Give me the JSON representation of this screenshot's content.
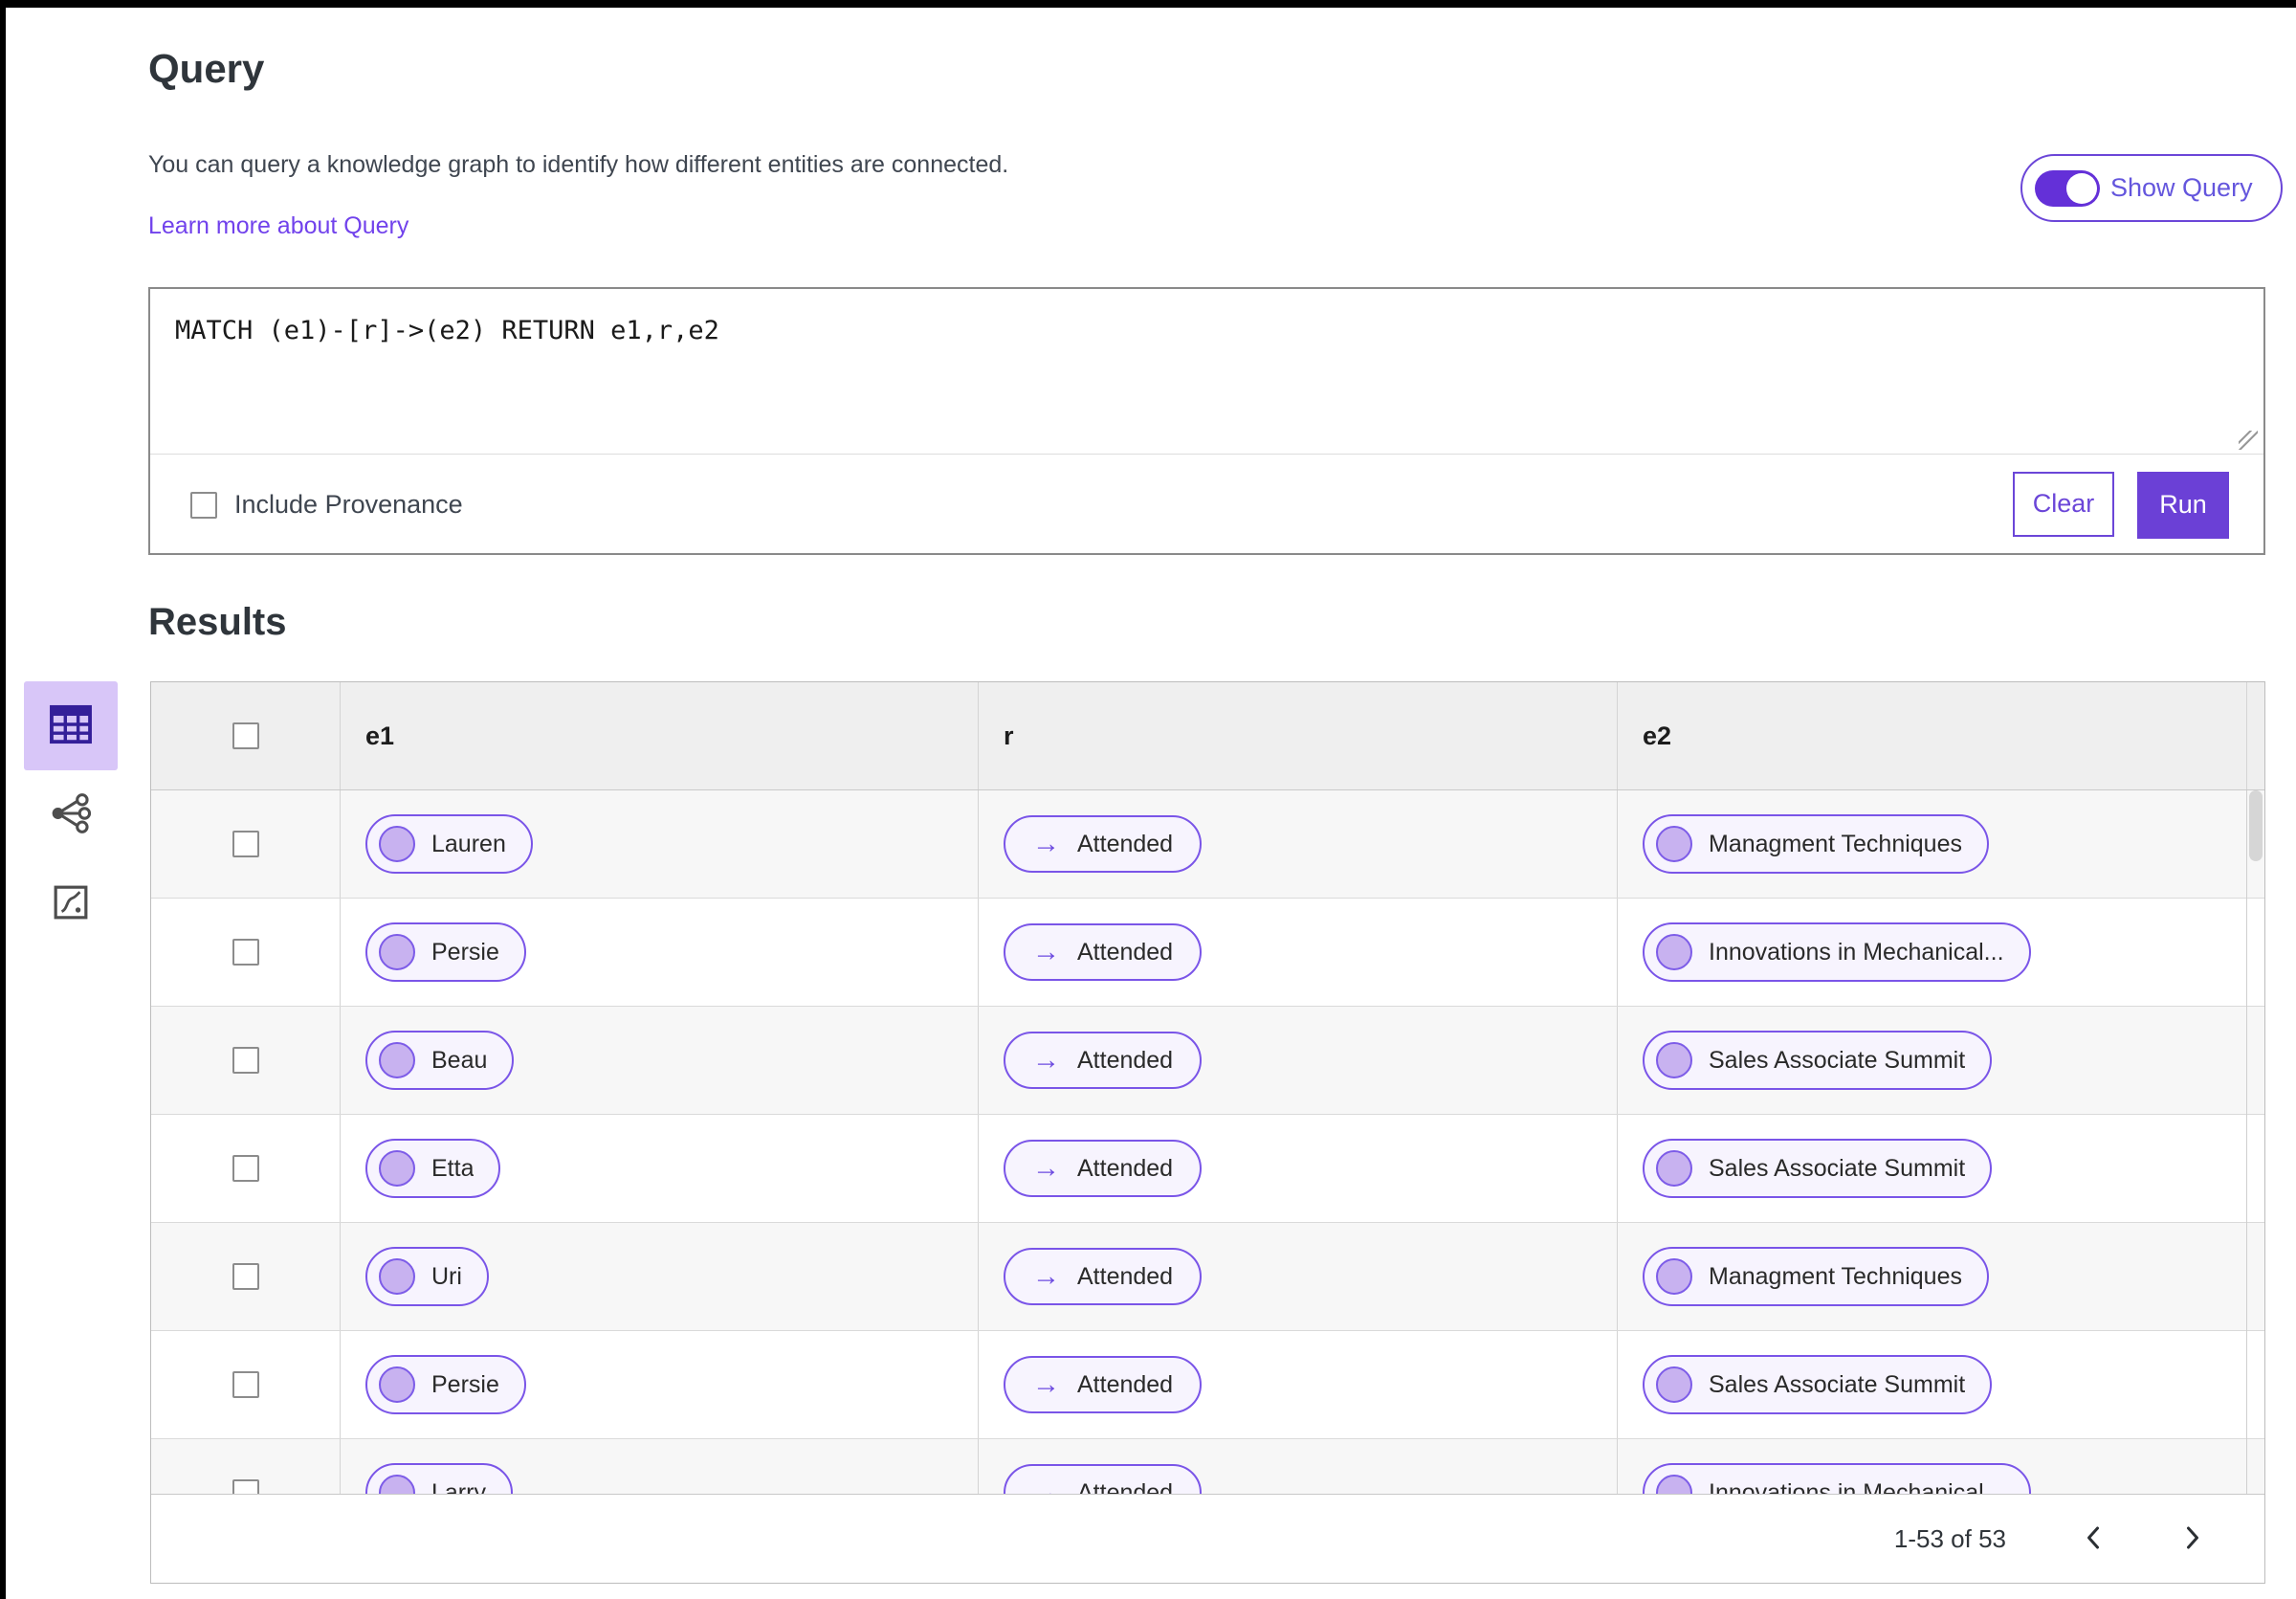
{
  "query": {
    "title": "Query",
    "description": "You can query a knowledge graph to identify how different entities are connected.",
    "learn_more": "Learn more about Query",
    "show_query": "Show Query",
    "editor_text": "MATCH (e1)-[r]->(e2) RETURN e1,r,e2",
    "include_provenance": "Include Provenance",
    "clear": "Clear",
    "run": "Run"
  },
  "results": {
    "title": "Results",
    "columns": [
      "e1",
      "r",
      "e2"
    ],
    "arrow_icon": "→",
    "view_icons": [
      "table-view-icon",
      "graph-view-icon",
      "chart-view-icon"
    ],
    "rows": [
      {
        "e1": "Lauren",
        "r": "Attended",
        "e2": "Managment Techniques"
      },
      {
        "e1": "Persie",
        "r": "Attended",
        "e2": "Innovations in Mechanical..."
      },
      {
        "e1": "Beau",
        "r": "Attended",
        "e2": "Sales Associate Summit"
      },
      {
        "e1": "Etta",
        "r": "Attended",
        "e2": "Sales Associate Summit"
      },
      {
        "e1": "Uri",
        "r": "Attended",
        "e2": "Managment Techniques"
      },
      {
        "e1": "Persie",
        "r": "Attended",
        "e2": "Sales Associate Summit"
      },
      {
        "e1": "Larry",
        "r": "Attended",
        "e2": "Innovations in Mechanical..."
      }
    ],
    "pagination": {
      "range": "1-53 of 53",
      "prev_icon": "chevron-left",
      "next_icon": "chevron-right"
    }
  },
  "colors": {
    "accent": "#6b40d6",
    "pill_border": "#7a55e8",
    "pill_bg": "#f7f4fe",
    "entity_circle": "#c8b2f0",
    "selected_view_bg": "#d8c6f8",
    "selected_view_icon": "#341f99",
    "link": "#7142ec"
  }
}
